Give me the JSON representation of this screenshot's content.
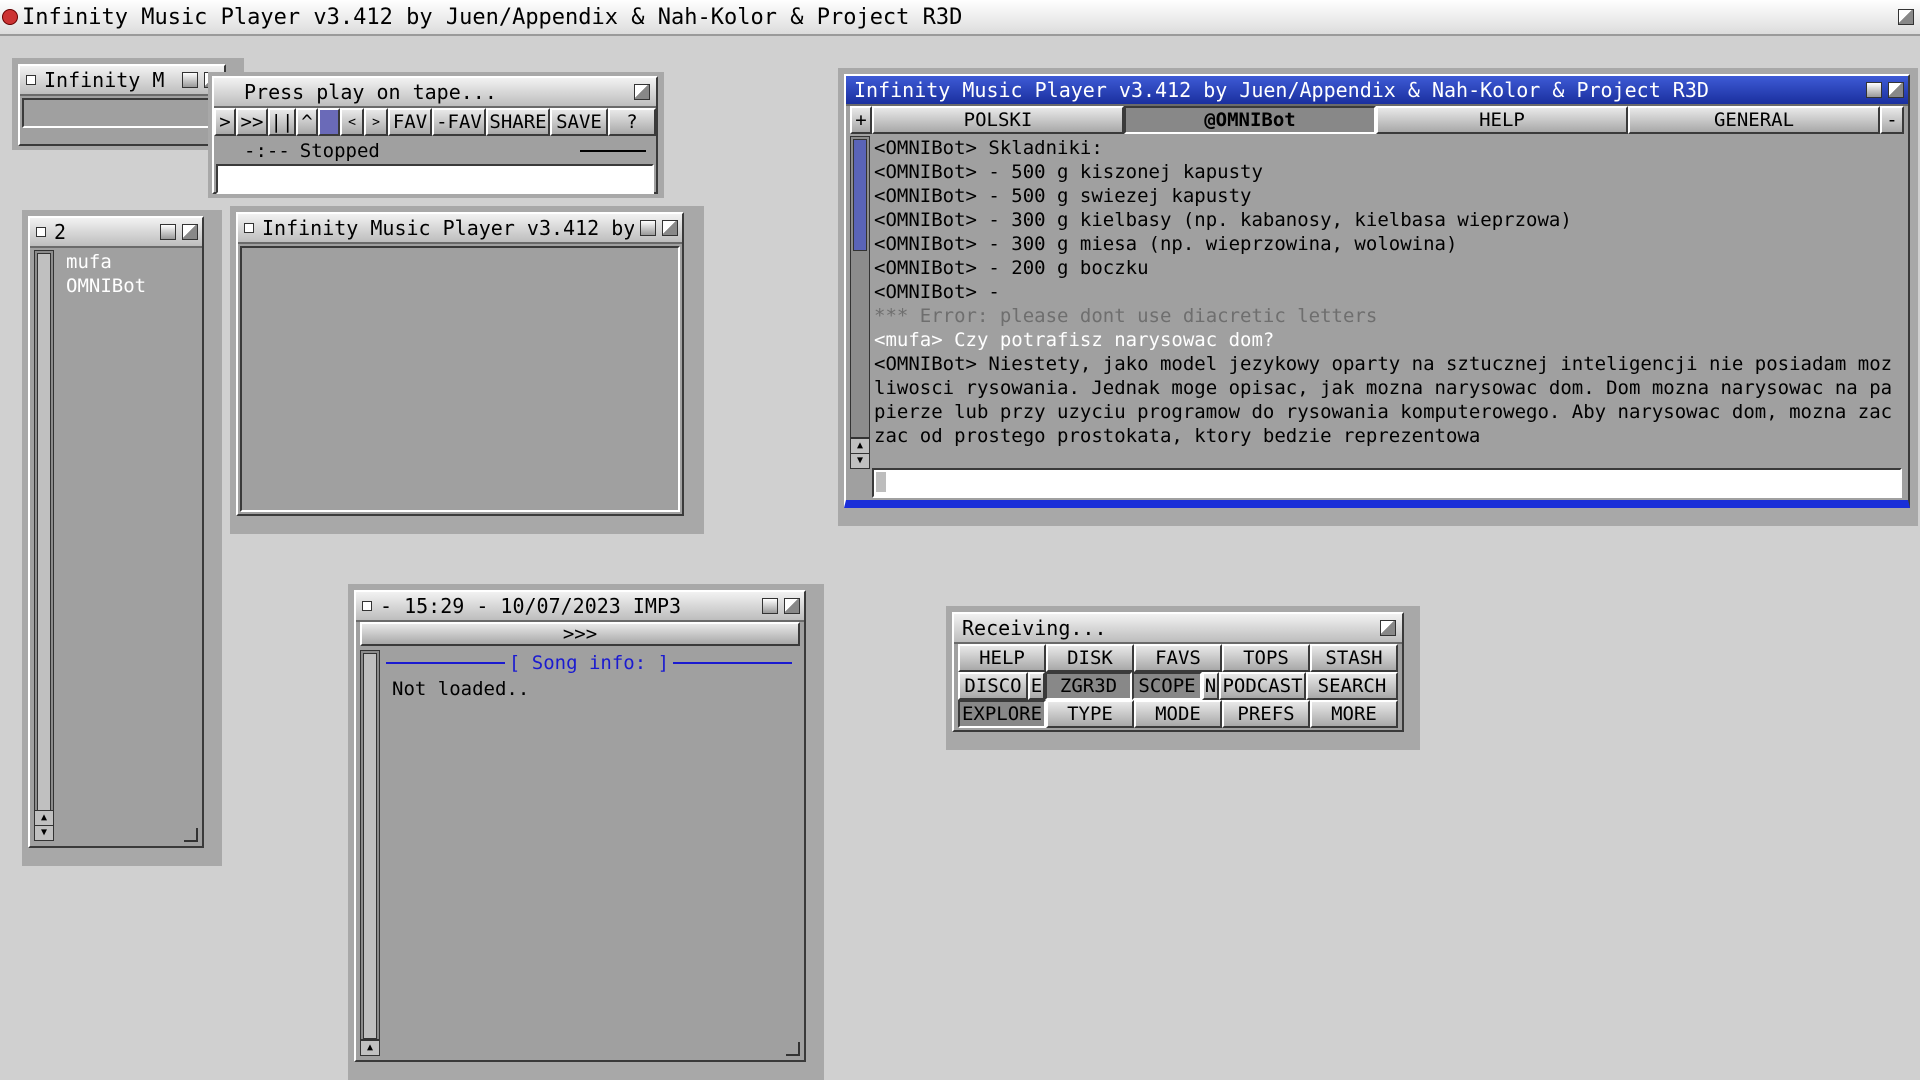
{
  "screen": {
    "title": "Infinity Music Player v3.412 by Juen/Appendix & Nah-Kolor & Project R3D"
  },
  "mini_window": {
    "title": "Infinity M"
  },
  "tape_window": {
    "title": "Press play on tape...",
    "controls": [
      ">",
      ">>",
      "||",
      "^",
      "",
      "<",
      ">",
      "FAV",
      "-FAV",
      "SHARE",
      "SAVE",
      "?"
    ],
    "position": "-:--",
    "status": "Stopped"
  },
  "userlist_window": {
    "title": "2",
    "users": [
      "mufa",
      "OMNIBot"
    ]
  },
  "empty_window": {
    "title": "Infinity Music Player v3.412 by"
  },
  "chat_window": {
    "title": "Infinity Music Player v3.412 by Juen/Appendix & Nah-Kolor & Project R3D",
    "add_tab": "+",
    "close_tab": "-",
    "tabs": [
      "POLSKI",
      "@OMNIBot",
      "HELP",
      "GENERAL"
    ],
    "lines": [
      {
        "kind": "bot",
        "text": "<OMNIBot> Skladniki:"
      },
      {
        "kind": "bot",
        "text": "<OMNIBot> - 500 g kiszonej kapusty"
      },
      {
        "kind": "bot",
        "text": "<OMNIBot> - 500 g swiezej kapusty"
      },
      {
        "kind": "bot",
        "text": "<OMNIBot> - 300 g kielbasy (np. kabanosy, kielbasa wieprzowa)"
      },
      {
        "kind": "bot",
        "text": "<OMNIBot> - 300 g miesa (np. wieprzowina, wolowina)"
      },
      {
        "kind": "bot",
        "text": "<OMNIBot> - 200 g boczku"
      },
      {
        "kind": "bot",
        "text": "<OMNIBot> -"
      },
      {
        "kind": "err",
        "text": "*** Error: please dont use diacretic letters"
      },
      {
        "kind": "me",
        "text": "<mufa> Czy potrafisz narysowac dom?"
      }
    ],
    "last_message": "<OMNIBot> Niestety, jako model jezykowy oparty na sztucznej inteligencji nie posiadam mozliwosci rysowania. Jednak moge opisac, jak mozna narysowac dom. Dom mozna narysowac na papierze lub przy uzyciu programow do rysowania komputerowego. Aby narysowac dom, mozna zaczac od prostego prostokata, ktory bedzie reprezentowa",
    "input_value": ""
  },
  "songinfo_window": {
    "title": "- 15:29 - 10/07/2023 IMP3",
    "nav": ">>>",
    "header": "[ Song info: ]",
    "text": "Not loaded.."
  },
  "menu_window": {
    "title": "Receiving...",
    "rows": [
      [
        "HELP",
        "DISK",
        "FAVS",
        "TOPS",
        "STASH"
      ],
      [
        "DISCO",
        "E",
        "ZGR3D",
        "SCOPE",
        "N",
        "PODCAST",
        "SEARCH"
      ],
      [
        "EXPLORE",
        "TYPE",
        "MODE",
        "PREFS",
        "MORE"
      ]
    ]
  },
  "colors": {
    "desktop": "#d0d0d0",
    "window": "#a0a0a0",
    "active_title": "#2a46c4",
    "song_header": "#1a1ad0"
  }
}
